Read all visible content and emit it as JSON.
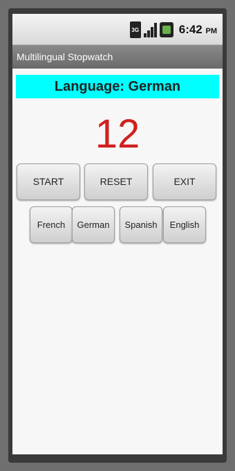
{
  "statusbar": {
    "network_badge": "3G",
    "time": "6:42",
    "ampm": "PM"
  },
  "app": {
    "title": "Multilingual Stopwatch"
  },
  "language_banner": "Language: German",
  "counter_value": "12",
  "controls": {
    "start_label": "START",
    "reset_label": "RESET",
    "exit_label": "EXIT"
  },
  "languages": {
    "french": "French",
    "german": "German",
    "spanish": "Spanish",
    "english": "English"
  },
  "colors": {
    "banner_bg": "#00ffff",
    "counter_text": "#d21f1f"
  }
}
